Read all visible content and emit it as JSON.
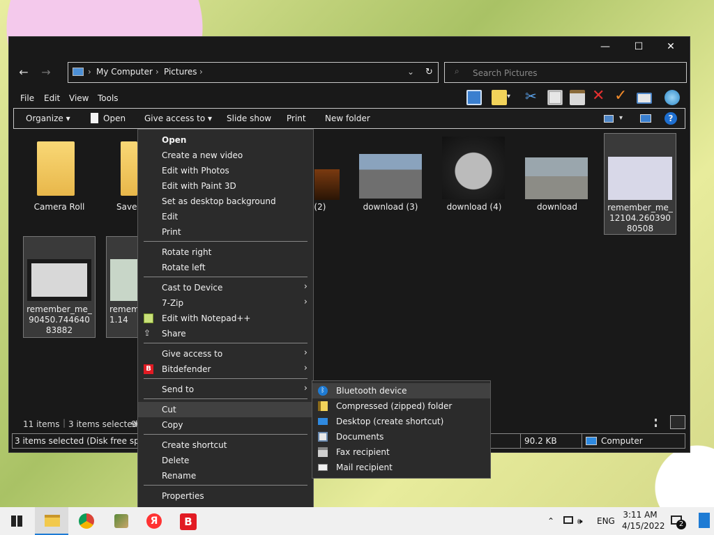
{
  "window": {
    "minimize": "—",
    "maximize": "☐",
    "close": "✕"
  },
  "address": {
    "crumbs": [
      "My Computer",
      "Pictures"
    ],
    "search_placeholder": "Search Pictures"
  },
  "menu": [
    "File",
    "Edit",
    "View",
    "Tools"
  ],
  "commands": [
    "Organize",
    "Open",
    "Give access to",
    "Slide show",
    "Print",
    "New folder"
  ],
  "items": [
    {
      "label": "Camera Roll"
    },
    {
      "label": "Saved"
    },
    {
      "label": "d (2)"
    },
    {
      "label": "download (3)"
    },
    {
      "label": "download (4)"
    },
    {
      "label": "download"
    },
    {
      "label": "remember_me_12104.26039080508"
    },
    {
      "label": "remember_me_90450.74464083882"
    },
    {
      "label": "remem 9921.14"
    }
  ],
  "status": {
    "count": "11 items",
    "selected": "3 items selected",
    "selected_trail": "90",
    "bar_left": "3 items selected (Disk free space:",
    "size": "90.2 KB",
    "location": "Computer"
  },
  "context_menu": {
    "items": [
      {
        "label": "Open"
      },
      {
        "label": "Create a new video"
      },
      {
        "label": "Edit with Photos"
      },
      {
        "label": "Edit with Paint 3D"
      },
      {
        "label": "Set as desktop background"
      },
      {
        "label": "Edit"
      },
      {
        "label": "Print"
      },
      {
        "label": "Rotate right"
      },
      {
        "label": "Rotate left"
      },
      {
        "label": "Cast to Device"
      },
      {
        "label": "7-Zip"
      },
      {
        "label": "Edit with Notepad++"
      },
      {
        "label": "Share"
      },
      {
        "label": "Give access to"
      },
      {
        "label": "Bitdefender"
      },
      {
        "label": "Send to"
      },
      {
        "label": "Cut"
      },
      {
        "label": "Copy"
      },
      {
        "label": "Create shortcut"
      },
      {
        "label": "Delete"
      },
      {
        "label": "Rename"
      },
      {
        "label": "Properties"
      }
    ]
  },
  "send_to_menu": {
    "items": [
      {
        "label": "Bluetooth device"
      },
      {
        "label": "Compressed (zipped) folder"
      },
      {
        "label": "Desktop (create shortcut)"
      },
      {
        "label": "Documents"
      },
      {
        "label": "Fax recipient"
      },
      {
        "label": "Mail recipient"
      }
    ]
  },
  "taskbar": {
    "language": "ENG",
    "time": "3:11 AM",
    "date": "4/15/2022",
    "notifications": "2"
  },
  "colors": {
    "accent": "#1e7bd4",
    "bitdefender": "#e21b23",
    "yandex": "#ff3333"
  }
}
